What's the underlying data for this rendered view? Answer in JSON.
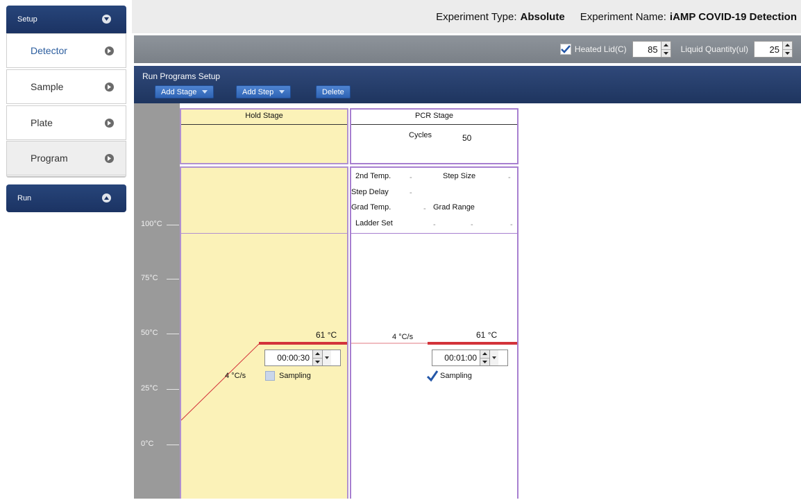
{
  "nav": {
    "setup_label": "Setup",
    "items": [
      {
        "label": "Detector"
      },
      {
        "label": "Sample"
      },
      {
        "label": "Plate"
      },
      {
        "label": "Program"
      }
    ],
    "run_label": "Run"
  },
  "header": {
    "experiment_type_label": "Experiment Type:",
    "experiment_type_value": "Absolute",
    "experiment_name_label": "Experiment Name:",
    "experiment_name_value": "iAMP COVID-19 Detection"
  },
  "settings": {
    "heated_lid_label": "Heated Lid(C)",
    "heated_lid_checked": true,
    "heated_lid_value": "85",
    "liquid_quantity_label": "Liquid Quantity(ul)",
    "liquid_quantity_value": "25"
  },
  "program": {
    "title": "Run Programs Setup",
    "add_stage_label": "Add Stage",
    "add_step_label": "Add Step",
    "delete_label": "Delete",
    "y_axis": [
      "100°C",
      "75°C",
      "50°C",
      "25°C",
      "0°C"
    ],
    "hold_stage": {
      "title": "Hold Stage",
      "temp": "61",
      "temp_unit": "°C",
      "ramp_rate": "4",
      "ramp_unit": "°C/s",
      "time": "00:00:30",
      "sampling_label": "Sampling",
      "sampling_checked": false
    },
    "pcr_stage": {
      "title": "PCR Stage",
      "cycles_label": "Cycles",
      "cycles_value": "50",
      "second_temp_label": "2nd Temp.",
      "step_size_label": "Step Size",
      "step_delay_label": "Step Delay",
      "grad_temp_label": "Grad Temp.",
      "grad_range_label": "Grad Range",
      "ladder_set_label": "Ladder Set",
      "dash": "-",
      "temp": "61",
      "temp_unit": "°C",
      "ramp_rate": "4",
      "ramp_unit": "°C/s",
      "time": "00:01:00",
      "sampling_label": "Sampling",
      "sampling_checked": true
    }
  },
  "colors": {
    "nav_header": "#1b3363",
    "program_header": "#1e355f",
    "hold_fill": "#fbf2b8",
    "stage_border": "#b090d0",
    "temp_line": "#d3333a"
  }
}
